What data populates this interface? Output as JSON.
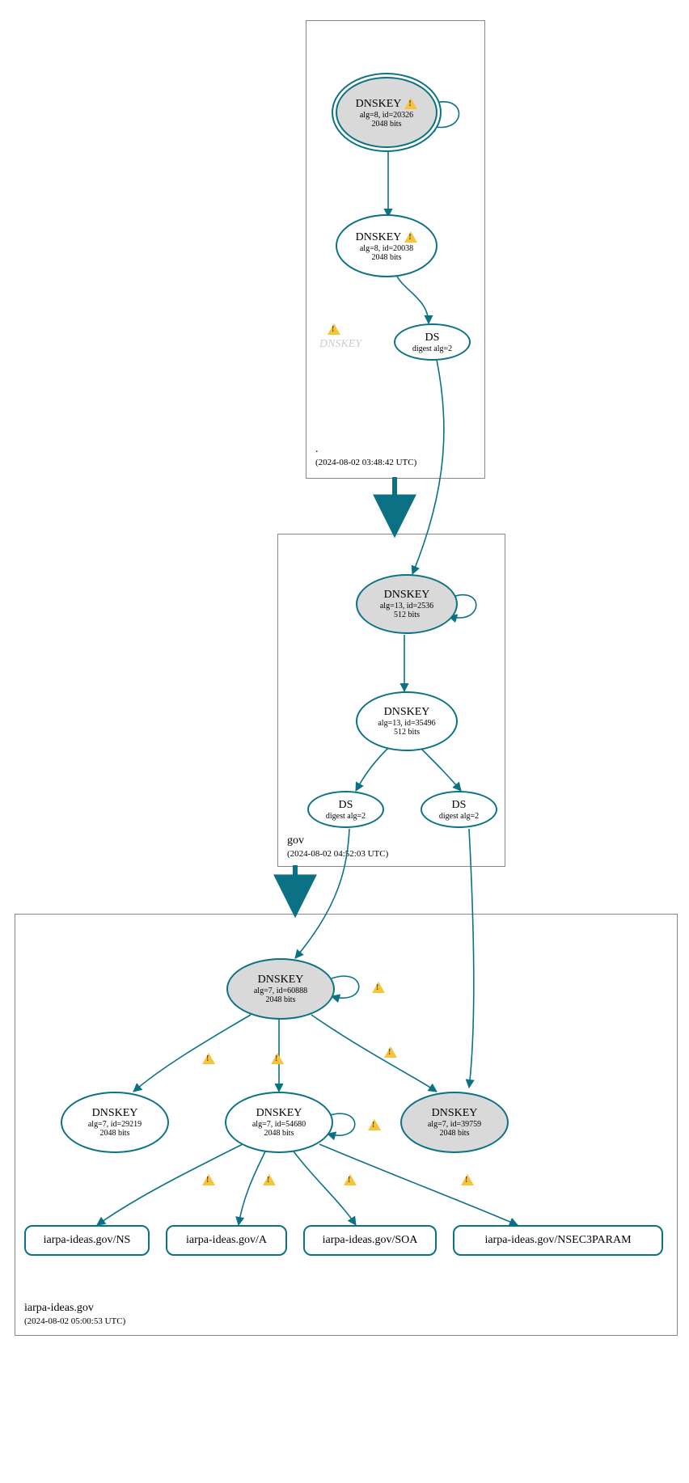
{
  "colors": {
    "stroke": "#0b7285"
  },
  "zones": {
    "root": {
      "label": ".",
      "timestamp": "(2024-08-02 03:48:42 UTC)"
    },
    "gov": {
      "label": "gov",
      "timestamp": "(2024-08-02 04:52:03 UTC)"
    },
    "iarpa": {
      "label": "iarpa-ideas.gov",
      "timestamp": "(2024-08-02 05:00:53 UTC)"
    }
  },
  "nodes": {
    "root_ksk": {
      "title": "DNSKEY",
      "l1": "alg=8, id=20326",
      "l2": "2048 bits",
      "warn": true
    },
    "root_zsk": {
      "title": "DNSKEY",
      "l1": "alg=8, id=20038",
      "l2": "2048 bits",
      "warn": true
    },
    "root_ds": {
      "title": "DS",
      "l1": "digest alg=2"
    },
    "ghost": {
      "label": "DNSKEY"
    },
    "gov_ksk": {
      "title": "DNSKEY",
      "l1": "alg=13, id=2536",
      "l2": "512 bits"
    },
    "gov_zsk": {
      "title": "DNSKEY",
      "l1": "alg=13, id=35496",
      "l2": "512 bits"
    },
    "gov_ds1": {
      "title": "DS",
      "l1": "digest alg=2"
    },
    "gov_ds2": {
      "title": "DS",
      "l1": "digest alg=2"
    },
    "ia_ksk": {
      "title": "DNSKEY",
      "l1": "alg=7, id=60888",
      "l2": "2048 bits"
    },
    "ia_k2": {
      "title": "DNSKEY",
      "l1": "alg=7, id=29219",
      "l2": "2048 bits"
    },
    "ia_zsk": {
      "title": "DNSKEY",
      "l1": "alg=7, id=54680",
      "l2": "2048 bits"
    },
    "ia_k4": {
      "title": "DNSKEY",
      "l1": "alg=7, id=39759",
      "l2": "2048 bits"
    },
    "rr_ns": {
      "label": "iarpa-ideas.gov/NS"
    },
    "rr_a": {
      "label": "iarpa-ideas.gov/A"
    },
    "rr_soa": {
      "label": "iarpa-ideas.gov/SOA"
    },
    "rr_nsec3": {
      "label": "iarpa-ideas.gov/NSEC3PARAM"
    }
  }
}
